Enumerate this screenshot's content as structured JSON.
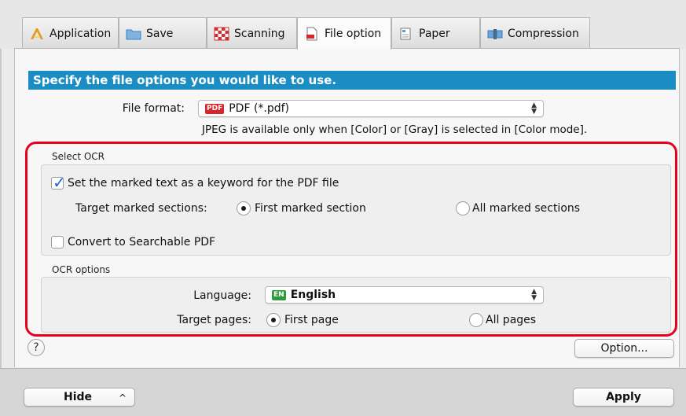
{
  "tabs": [
    {
      "label": "Application",
      "icon": "application-icon"
    },
    {
      "label": "Save",
      "icon": "folder-icon"
    },
    {
      "label": "Scanning",
      "icon": "scanning-icon"
    },
    {
      "label": "File option",
      "icon": "file-icon",
      "active": true
    },
    {
      "label": "Paper",
      "icon": "paper-icon"
    },
    {
      "label": "Compression",
      "icon": "compression-icon"
    }
  ],
  "banner": "Specify the file options you would like to use.",
  "file_format": {
    "label": "File format:",
    "value": "PDF (*.pdf)",
    "badge": "PDF",
    "note": "JPEG is available only when [Color] or [Gray] is selected in [Color mode]."
  },
  "select_ocr": {
    "title": "Select OCR",
    "keyword_checkbox": {
      "label": "Set the marked text as a keyword for the PDF file",
      "checked": true
    },
    "target_label": "Target marked sections:",
    "options": [
      {
        "label": "First marked section",
        "selected": true
      },
      {
        "label": "All marked sections",
        "selected": false
      }
    ],
    "searchable_checkbox": {
      "label": "Convert to Searchable PDF",
      "checked": false
    }
  },
  "ocr_options": {
    "title": "OCR options",
    "language_label": "Language:",
    "language_value": "English",
    "language_badge": "EN",
    "target_pages_label": "Target pages:",
    "pages_options": [
      {
        "label": "First page",
        "selected": true
      },
      {
        "label": "All pages",
        "selected": false
      }
    ]
  },
  "help_label": "?",
  "option_button": "Option...",
  "hide_button": "Hide",
  "hide_chevron": "^",
  "apply_button": "Apply",
  "colors": {
    "banner": "#1a8dc4",
    "highlight_box": "#e8001e"
  }
}
